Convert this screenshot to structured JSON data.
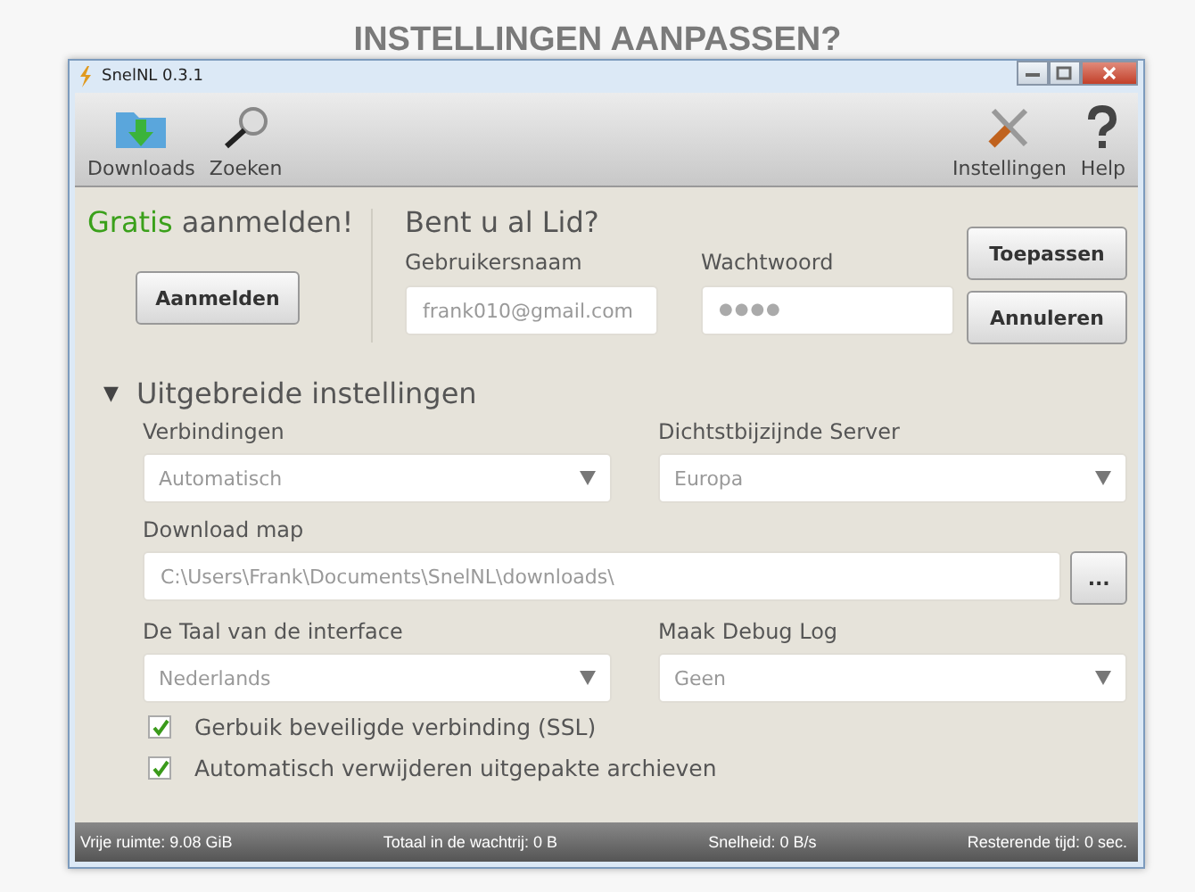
{
  "page_heading": "INSTELLINGEN AANPASSEN?",
  "window": {
    "title": "SnelNL 0.3.1"
  },
  "toolbar": {
    "left": [
      {
        "label": "Downloads",
        "kind": "downloads"
      },
      {
        "label": "Zoeken",
        "kind": "search"
      }
    ],
    "right": [
      {
        "label": "Instellingen",
        "kind": "settings"
      },
      {
        "label": "Help",
        "kind": "help"
      }
    ]
  },
  "signup": {
    "heading": "**Gratis** aanmelden!",
    "button": "Aanmelden"
  },
  "login": {
    "heading": "Bent u al Lid?",
    "username_label": "Gebruikersnaam",
    "username": "frank010@gmail.com",
    "password_label": "Wachtwoord",
    "password": "●●●●"
  },
  "buttons": [
    "Toepassen",
    "Annuleren"
  ],
  "advanced": {
    "heading": "Uitgebreide instellingen",
    "expanded": true,
    "expander": "▼",
    "rows": [
      {
        "kind": "selects",
        "fields": [
          {
            "label": "Verbindingen",
            "value": "Automatisch"
          },
          {
            "label": "Dichtstbijzijnde Server",
            "value": "Europa"
          }
        ]
      },
      {
        "kind": "path",
        "label": "Download map",
        "value": "C:\\Users\\Frank\\Documents\\SnelNL\\downloads\\",
        "button": "..."
      },
      {
        "kind": "selects",
        "fields": [
          {
            "label": "De Taal van de interface",
            "value": "Nederlands"
          },
          {
            "label": "Maak Debug Log",
            "value": "Geen"
          }
        ]
      }
    ],
    "checkboxes": [
      {
        "label": "Gerbuik beveiligde verbinding (SSL)",
        "checked": true
      },
      {
        "label": "Automatisch verwijderen uitgepakte archieven",
        "checked": true
      }
    ]
  },
  "status_bar": [
    "Vrije ruimte: 9.08 GiB",
    "Totaal in de wachtrij: 0 B",
    "Snelheid: 0 B/s",
    "Resterende tijd:  0 sec."
  ]
}
